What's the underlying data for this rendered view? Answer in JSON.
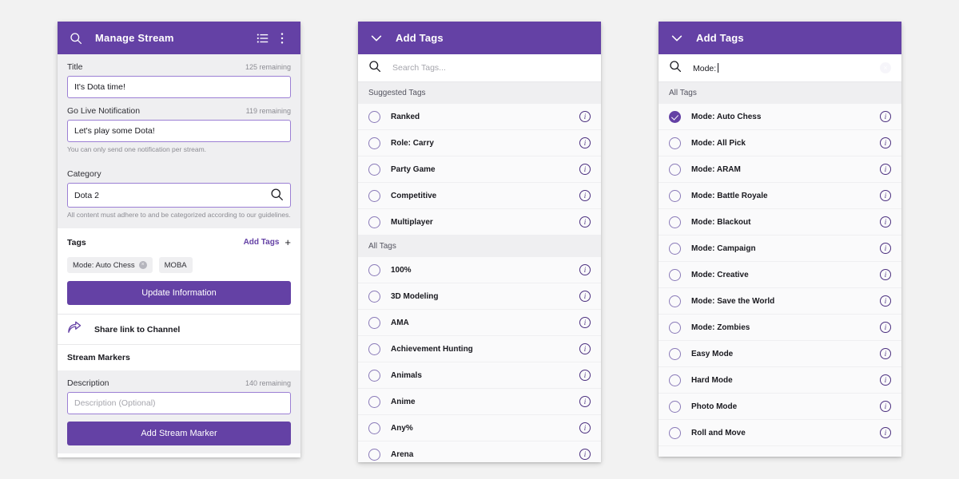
{
  "theme": {
    "brand_purple": "#6441a5",
    "panel_bg": "#ffffff",
    "section_grey": "#efeff1",
    "page_bg": "#f2f2f2",
    "row_bg": "#fafafb",
    "info_icon_color": "#4b2f7f"
  },
  "manage_stream": {
    "header": {
      "title": "Manage Stream",
      "search_icon": "search-icon",
      "list_icon": "list-icon",
      "overflow_icon": "more-vertical-icon"
    },
    "title_field": {
      "label": "Title",
      "counter": "125 remaining",
      "value": "It's Dota time!"
    },
    "go_live_field": {
      "label": "Go Live Notification",
      "counter": "119 remaining",
      "value": "Let's play some Dota!",
      "helper": "You can only send one notification per stream."
    },
    "category_field": {
      "label": "Category",
      "value": "Dota 2",
      "search_icon": "search-icon",
      "helper": "All content must adhere to and be categorized according to our guidelines."
    },
    "tags": {
      "label": "Tags",
      "add_label": "Add Tags",
      "add_plus": "+",
      "chips": [
        {
          "label": "Mode: Auto Chess",
          "removable": true,
          "remove_glyph": "×"
        },
        {
          "label": "MOBA",
          "removable": false
        }
      ]
    },
    "update_button": "Update Information",
    "share_row": {
      "label": "Share link to Channel",
      "icon": "share-arrow-icon"
    },
    "stream_markers_heading": "Stream Markers",
    "description_field": {
      "label": "Description",
      "counter": "140 remaining",
      "placeholder": "Description (Optional)",
      "value": ""
    },
    "add_marker_button": "Add Stream Marker"
  },
  "add_tags": {
    "header": {
      "title": "Add Tags",
      "collapse_icon": "chevron-down-icon"
    },
    "search": {
      "icon": "search-icon",
      "placeholder": "Search Tags...",
      "value": ""
    },
    "groups": [
      {
        "heading": "Suggested Tags",
        "items": [
          {
            "label": "Ranked",
            "checked": false
          },
          {
            "label": "Role: Carry",
            "checked": false
          },
          {
            "label": "Party Game",
            "checked": false
          },
          {
            "label": "Competitive",
            "checked": false
          },
          {
            "label": "Multiplayer",
            "checked": false
          }
        ]
      },
      {
        "heading": "All Tags",
        "items": [
          {
            "label": "100%",
            "checked": false
          },
          {
            "label": "3D Modeling",
            "checked": false
          },
          {
            "label": "AMA",
            "checked": false
          },
          {
            "label": "Achievement Hunting",
            "checked": false
          },
          {
            "label": "Animals",
            "checked": false
          },
          {
            "label": "Anime",
            "checked": false
          },
          {
            "label": "Any%",
            "checked": false
          },
          {
            "label": "Arena",
            "checked": false
          }
        ]
      }
    ]
  },
  "mode_tags": {
    "header": {
      "title": "Add Tags",
      "collapse_icon": "chevron-down-icon"
    },
    "search": {
      "icon": "search-icon",
      "value": "Mode:",
      "clear_icon": "clear-icon",
      "clear_glyph": "×"
    },
    "groups": [
      {
        "heading": "All Tags",
        "items": [
          {
            "label": "Mode: Auto Chess",
            "checked": true
          },
          {
            "label": "Mode: All Pick",
            "checked": false
          },
          {
            "label": "Mode: ARAM",
            "checked": false
          },
          {
            "label": "Mode: Battle Royale",
            "checked": false
          },
          {
            "label": "Mode: Blackout",
            "checked": false
          },
          {
            "label": "Mode: Campaign",
            "checked": false
          },
          {
            "label": "Mode: Creative",
            "checked": false
          },
          {
            "label": "Mode: Save the World",
            "checked": false
          },
          {
            "label": "Mode: Zombies",
            "checked": false
          },
          {
            "label": "Easy Mode",
            "checked": false
          },
          {
            "label": "Hard Mode",
            "checked": false
          },
          {
            "label": "Photo Mode",
            "checked": false
          },
          {
            "label": "Roll and Move",
            "checked": false
          }
        ]
      }
    ]
  }
}
